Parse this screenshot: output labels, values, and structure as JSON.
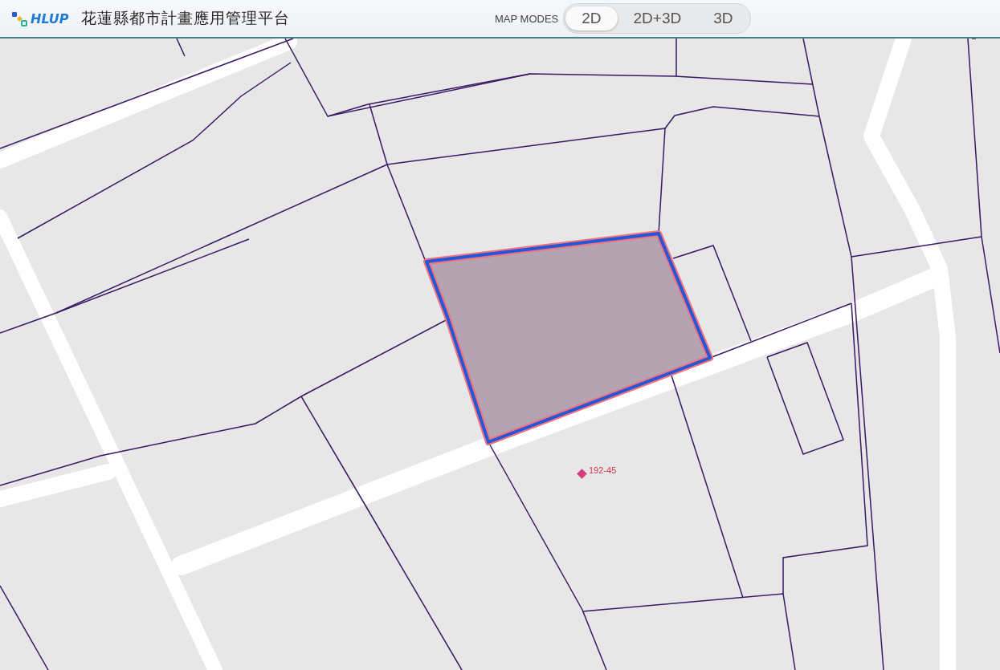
{
  "header": {
    "logo_text": "HLUP",
    "title": "花蓮縣都市計畫應用管理平台"
  },
  "map_modes": {
    "label": "MAP MODES",
    "modes": [
      {
        "label": "2D",
        "selected": true
      },
      {
        "label": "2D+3D",
        "selected": false
      },
      {
        "label": "3D",
        "selected": false
      }
    ]
  },
  "map": {
    "parcel_label": "192-45"
  }
}
